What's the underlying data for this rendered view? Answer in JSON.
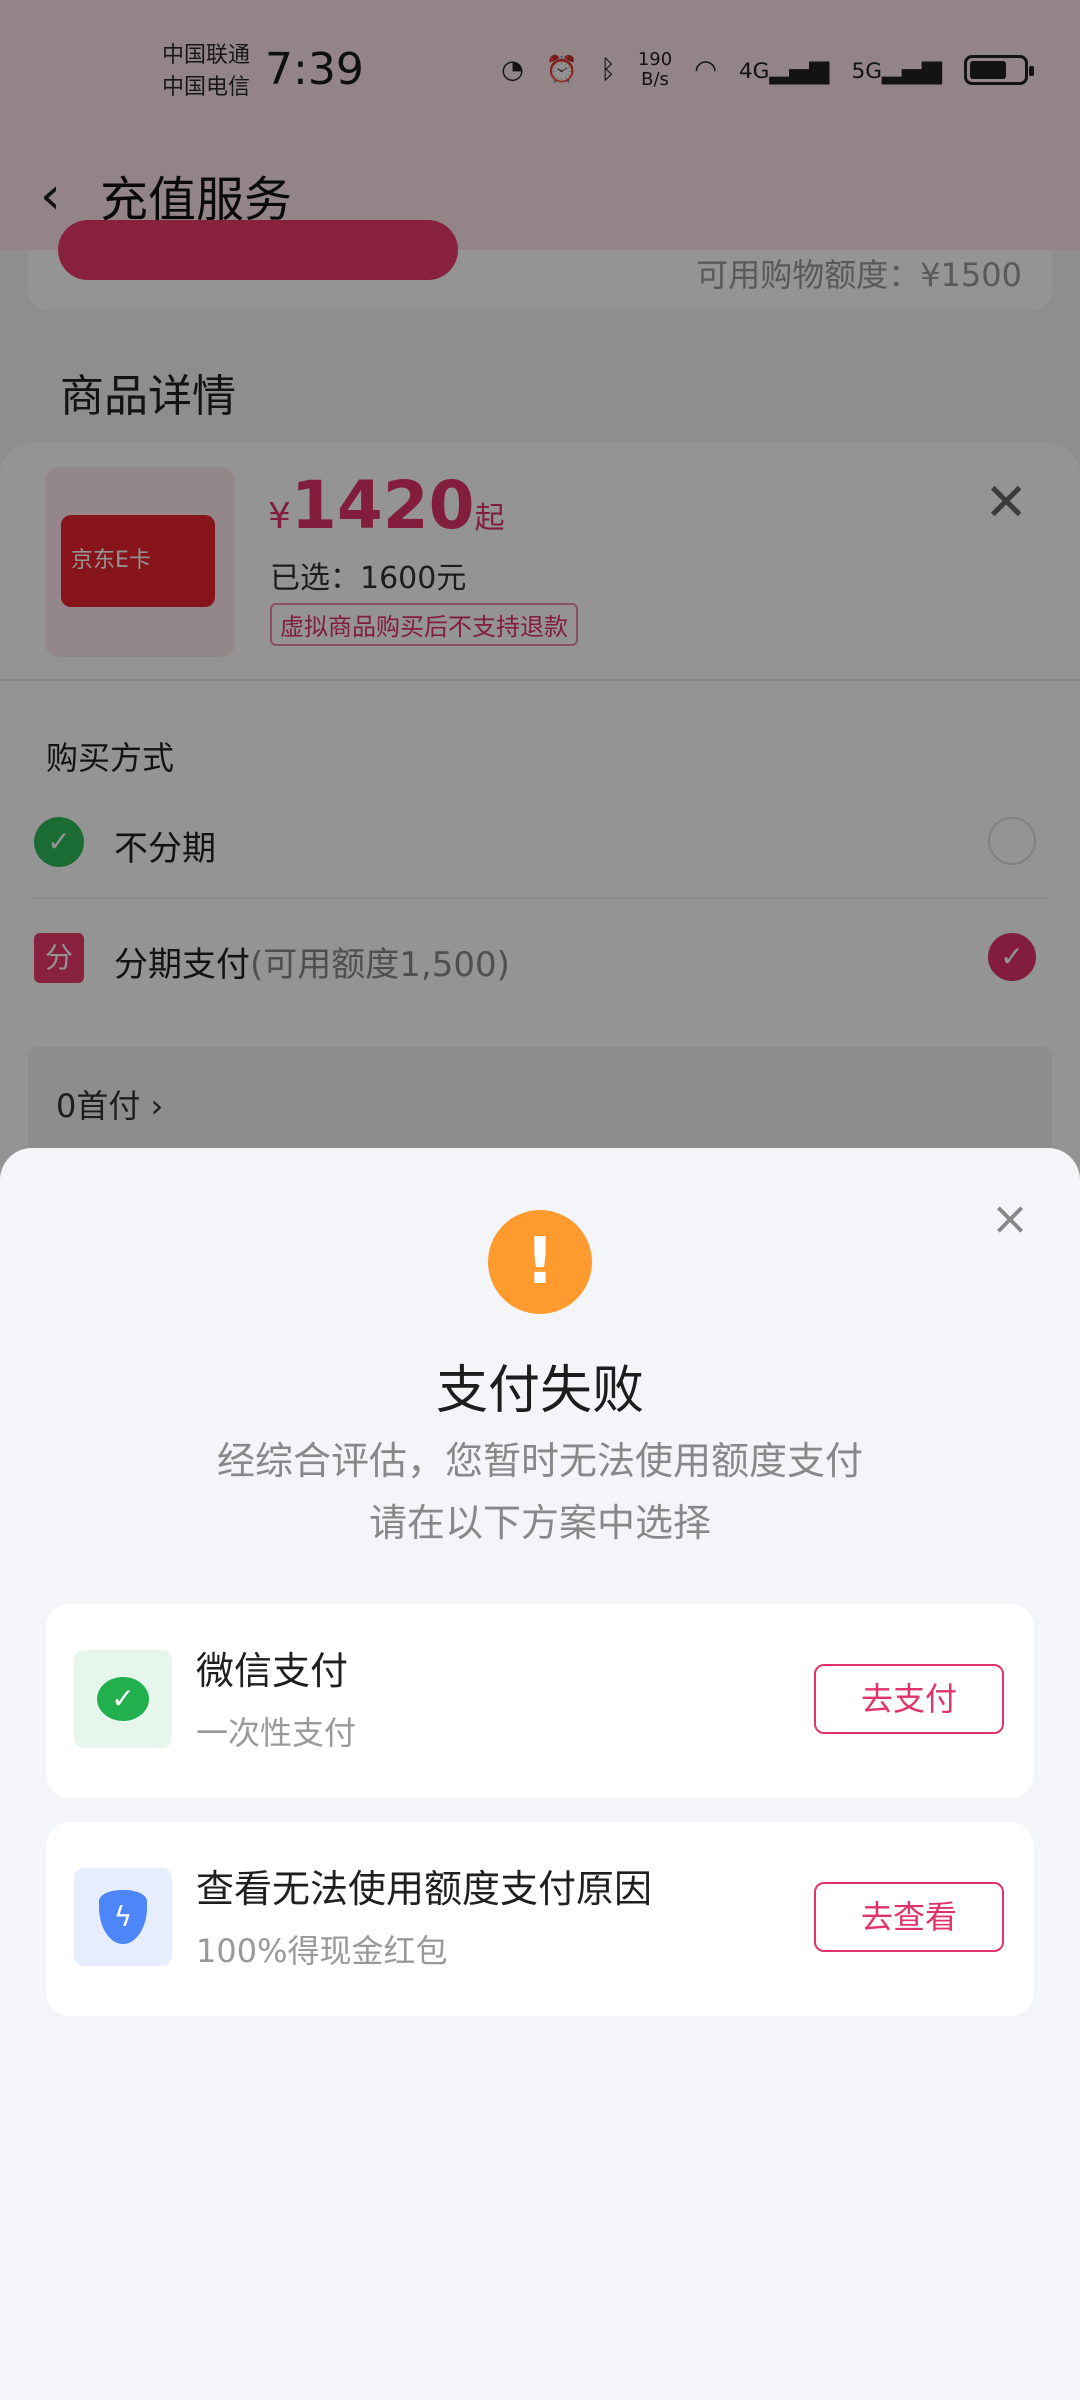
{
  "status_bar": {
    "carrier1": "中国联通",
    "carrier2": "中国电信",
    "time": "7:39",
    "net_speed_value": "190",
    "net_speed_unit": "B/s",
    "net1": "4G",
    "net2": "5G"
  },
  "header": {
    "title": "充值服务",
    "back_icon": "chevron-left-icon"
  },
  "background": {
    "credit_text": "可用购物额度：¥1500",
    "detail_title": "商品详情"
  },
  "product": {
    "card_text": "京东E卡",
    "price_symbol": "¥",
    "price": "1420",
    "price_suffix": "起",
    "selected": "已选：1600元",
    "notice": "虚拟商品购买后不支持退款"
  },
  "purchase": {
    "title": "购买方式",
    "options": [
      {
        "label": "不分期",
        "sub": "",
        "selected": false
      },
      {
        "label": "分期支付",
        "sub": "(可用额度1,500)",
        "selected": true
      }
    ],
    "plan": "0首付"
  },
  "modal": {
    "title": "支付失败",
    "desc_line1": "经综合评估，您暂时无法使用额度支付",
    "desc_line2": "请在以下方案中选择",
    "options": [
      {
        "title": "微信支付",
        "sub": "一次性支付",
        "button": "去支付",
        "icon": "wechat-icon"
      },
      {
        "title": "查看无法使用额度支付原因",
        "sub": "100%得现金红包",
        "button": "去查看",
        "icon": "shield-icon"
      }
    ]
  },
  "colors": {
    "accent": "#e03369",
    "warning": "#ff9a2e",
    "wechat": "#22b04e",
    "shield": "#4c86f8"
  }
}
